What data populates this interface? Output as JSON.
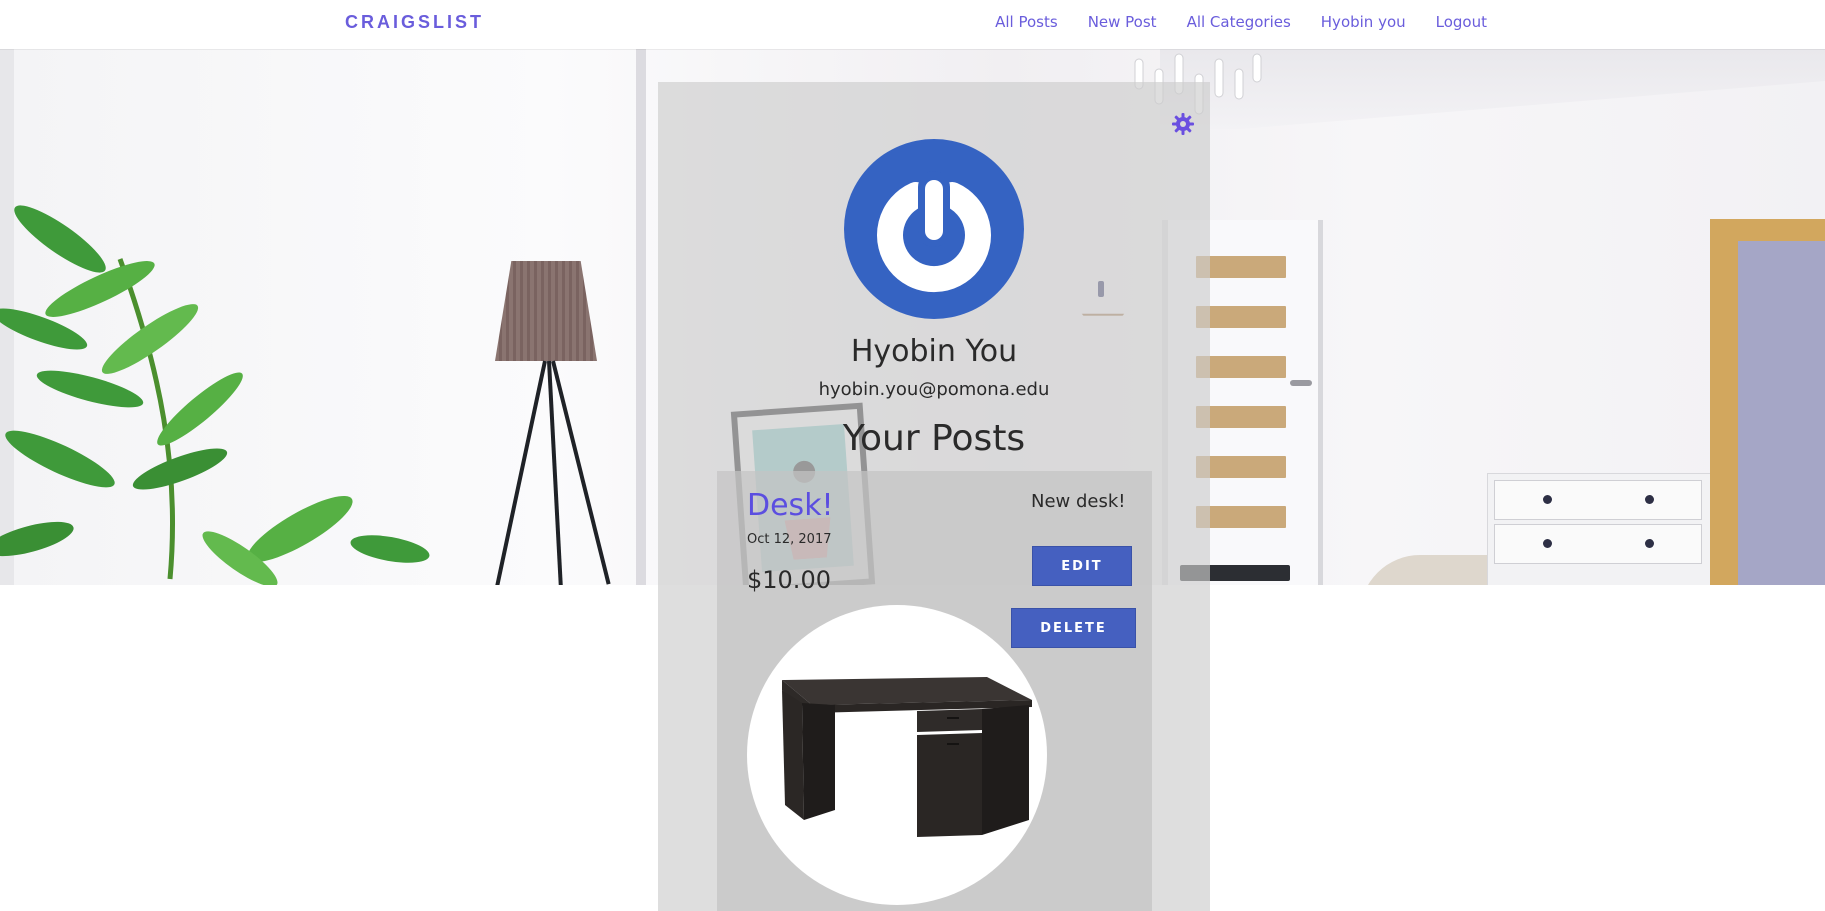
{
  "navbar": {
    "brand": "CRAIGSLIST",
    "links": [
      "All Posts",
      "New Post",
      "All Categories",
      "Hyobin you",
      "Logout"
    ]
  },
  "profile": {
    "name": "Hyobin You",
    "email": "hyobin.you@pomona.edu",
    "avatar_icon": "power-icon",
    "settings_icon": "gear-icon"
  },
  "posts_section": {
    "title": "Your Posts",
    "posts": [
      {
        "title": "Desk!",
        "date": "Oct 12, 2017",
        "price": "$10.00",
        "description": "New desk!",
        "edit_label": "EDIT",
        "delete_label": "DELETE"
      }
    ]
  },
  "colors": {
    "accent": "#6a5ddc",
    "button": "#4560c0",
    "avatar": "#3563c2"
  }
}
